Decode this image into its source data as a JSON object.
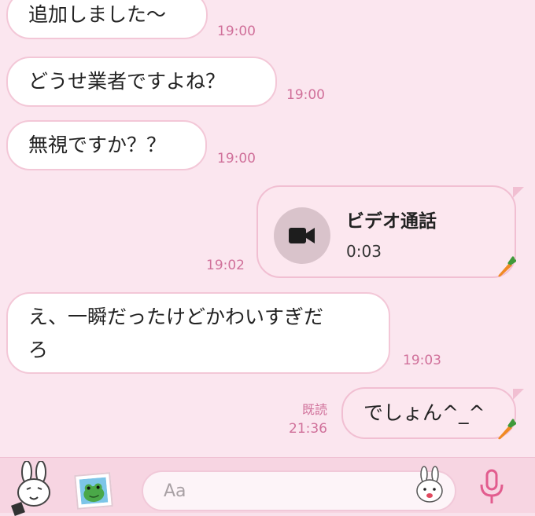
{
  "messages": [
    {
      "text": "追加しました〜",
      "time": "19:00"
    },
    {
      "text": "どうせ業者ですよね？",
      "time": "19:00"
    },
    {
      "text": "無視ですか？？",
      "time": "19:00"
    },
    {
      "title": "ビデオ通話",
      "duration": "0:03",
      "time": "19:02"
    },
    {
      "line1": "え、一瞬だったけどかわいすぎだ",
      "line2": "ろ",
      "time": "19:03"
    },
    {
      "text": "でしょん^_^",
      "read": "既読",
      "time": "21:36"
    }
  ],
  "composer": {
    "placeholder": "Aa"
  },
  "colors": {
    "background": "#fbe6ef",
    "bubble_border": "#f3c7d7",
    "time_text": "#d0709a",
    "outgoing_bubble": "#fce7ef"
  },
  "icons": [
    "video-camera-icon",
    "carrot-icon",
    "bunny-sticker-icon",
    "frog-photo-icon",
    "bunny-emoji-icon",
    "microphone-icon"
  ]
}
